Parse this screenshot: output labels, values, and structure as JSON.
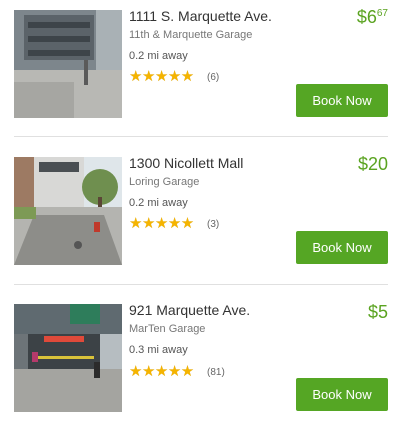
{
  "listings": [
    {
      "address": "1111 S. Marquette Ave.",
      "garage": "11th & Marquette Garage",
      "distance": "0.2 mi away",
      "rating": 4.5,
      "reviews": "(6)",
      "price_main": "$6",
      "price_cents": "67",
      "book_label": "Book Now"
    },
    {
      "address": "1300 Nicollett Mall",
      "garage": "Loring Garage",
      "distance": "0.2 mi away",
      "rating": 4.5,
      "reviews": "(3)",
      "price_main": "$20",
      "price_cents": "",
      "book_label": "Book Now"
    },
    {
      "address": "921 Marquette Ave.",
      "garage": "MarTen Garage",
      "distance": "0.3 mi away",
      "rating": 4.5,
      "reviews": "(81)",
      "price_main": "$5",
      "price_cents": "",
      "book_label": "Book Now"
    }
  ],
  "colors": {
    "accent": "#55a624",
    "price": "#5aa320",
    "star": "#f5b400"
  }
}
